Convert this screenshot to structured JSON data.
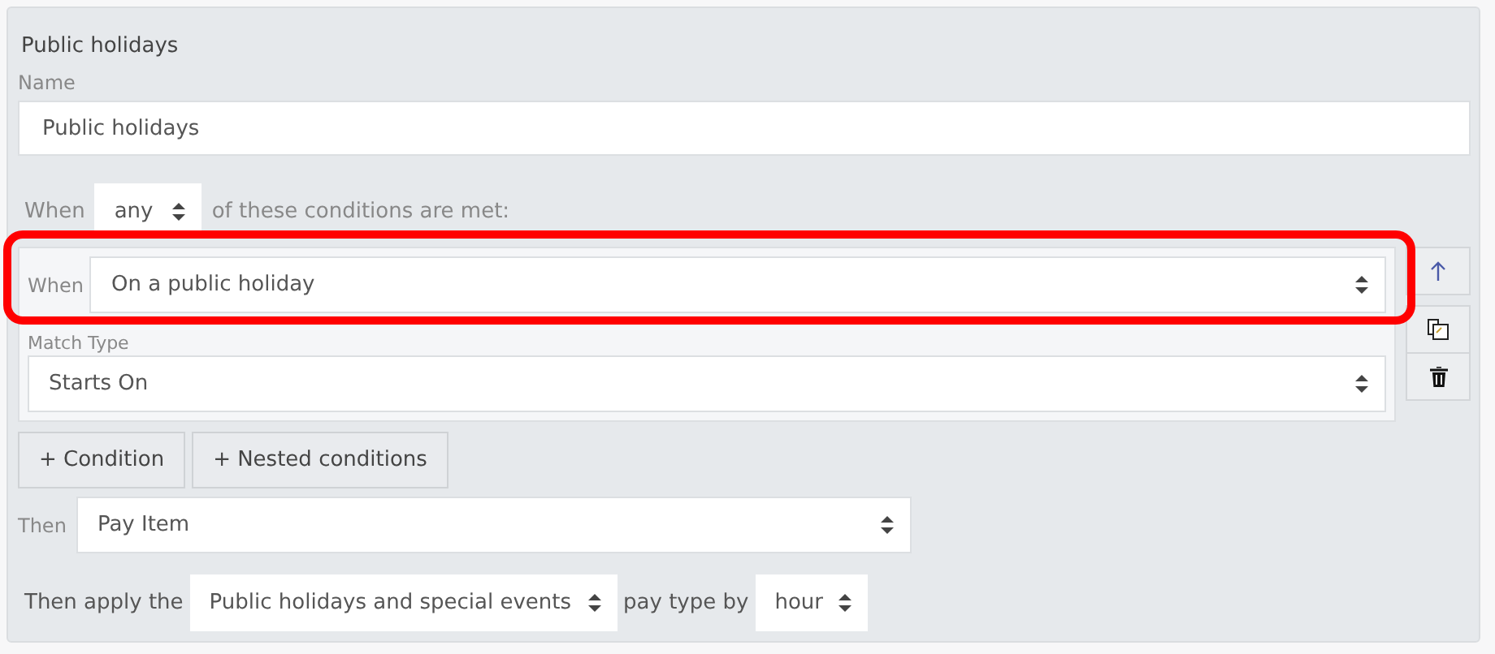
{
  "panel": {
    "title": "Public holidays"
  },
  "name_field": {
    "label": "Name",
    "value": "Public holidays"
  },
  "match_row": {
    "prefix": "When",
    "mode": "any",
    "suffix": "of these conditions are met:"
  },
  "condition": {
    "when_label": "When",
    "when_value": "On a public holiday",
    "match_label": "Match Type",
    "match_value": "Starts On",
    "highlighted": true
  },
  "side_actions": [
    {
      "kind": "up"
    },
    {
      "kind": "copy"
    },
    {
      "kind": "delete"
    }
  ],
  "add_buttons": [
    "+ Condition",
    "+ Nested conditions"
  ],
  "then_row": {
    "label": "Then",
    "value": "Pay Item"
  },
  "apply_row": {
    "prefix": "Then apply the",
    "pay_type": "Public holidays and special events",
    "middle": "pay type by",
    "unit": "hour"
  }
}
